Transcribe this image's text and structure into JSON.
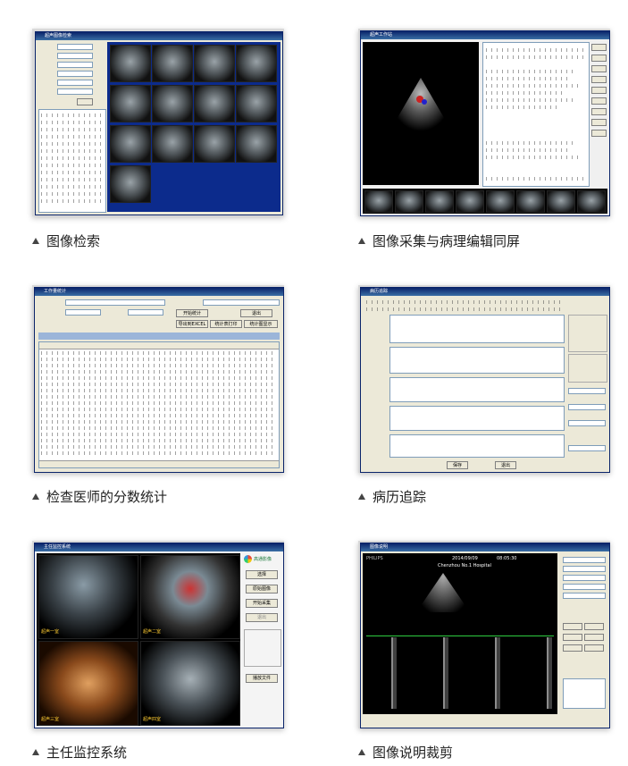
{
  "panels": [
    {
      "id": "image-search",
      "caption": "图像检索",
      "window_title": "超声图像检索"
    },
    {
      "id": "capture-edit",
      "caption": "图像采集与病理编辑同屏",
      "window_title": "超声工作站"
    },
    {
      "id": "doctor-score",
      "caption": "检查医师的分数统计",
      "window_title": "工作量统计",
      "buttons": [
        "开始统计",
        "退出",
        "导出到EXCEL",
        "统计表打印",
        "统计图显示"
      ]
    },
    {
      "id": "case-tracking",
      "caption": "病历追踪",
      "window_title": "病历追踪",
      "buttons": [
        "保存",
        "退出"
      ]
    },
    {
      "id": "director-monitor",
      "caption": "主任监控系统",
      "window_title": "主任监控系统",
      "brand": "高通影像",
      "buttons": [
        "选择",
        "原始图像",
        "开始采集",
        "退出",
        "播放文件"
      ],
      "quadrants": [
        "超声一室",
        "超声二室",
        "超声三室",
        "超声四室"
      ]
    },
    {
      "id": "image-crop",
      "caption": "图像说明裁剪",
      "window_title": "图像说明",
      "overlay_date": "2014/09/09",
      "overlay_time": "08:05:30",
      "overlay_hospital": "Chenzhou No.1 Hospital",
      "brand": "PHILIPS"
    }
  ]
}
